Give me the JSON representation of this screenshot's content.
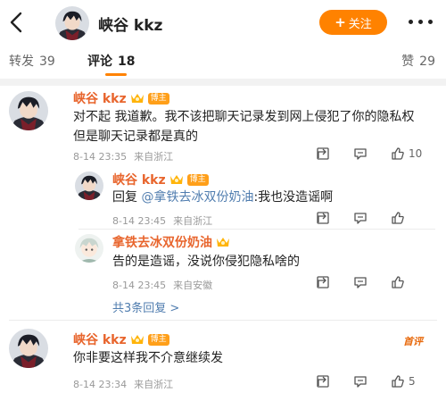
{
  "header": {
    "username": "峡谷 kkz",
    "follow_label": "关注",
    "follow_plus": "+"
  },
  "tabs": {
    "repost_label": "转发",
    "repost_count": "39",
    "comment_label": "评论",
    "comment_count": "18",
    "like_label": "赞",
    "like_count": "29"
  },
  "comments": [
    {
      "username": "峡谷 kkz",
      "badge": "博主",
      "text": "对不起 我道歉。我不该把聊天记录发到网上侵犯了你的隐私权 但是聊天记录都是真的",
      "date": "8-14 23:35",
      "location": "来自浙江",
      "like_count": "10"
    },
    {
      "username": "峡谷 kkz",
      "badge": "博主",
      "reply_prefix": "回复",
      "mention": "@拿铁去冰双份奶油",
      "text": ":我也没造谣啊",
      "date": "8-14 23:45",
      "location": "来自浙江"
    },
    {
      "username": "拿铁去冰双份奶油",
      "text": "告的是造谣，没说你侵犯隐私啥的",
      "date": "8-14 23:45",
      "location": "来自安徽"
    },
    {
      "username": "峡谷 kkz",
      "badge": "博主",
      "text": "你非要这样我不介意继续发",
      "date": "8-14 23:34",
      "location": "来自浙江",
      "like_count": "5",
      "tag": "首评"
    }
  ],
  "more_replies": "共3条回复 >",
  "colors": {
    "accent": "#ff8200",
    "username": "#e8652d",
    "link": "#507daf"
  }
}
